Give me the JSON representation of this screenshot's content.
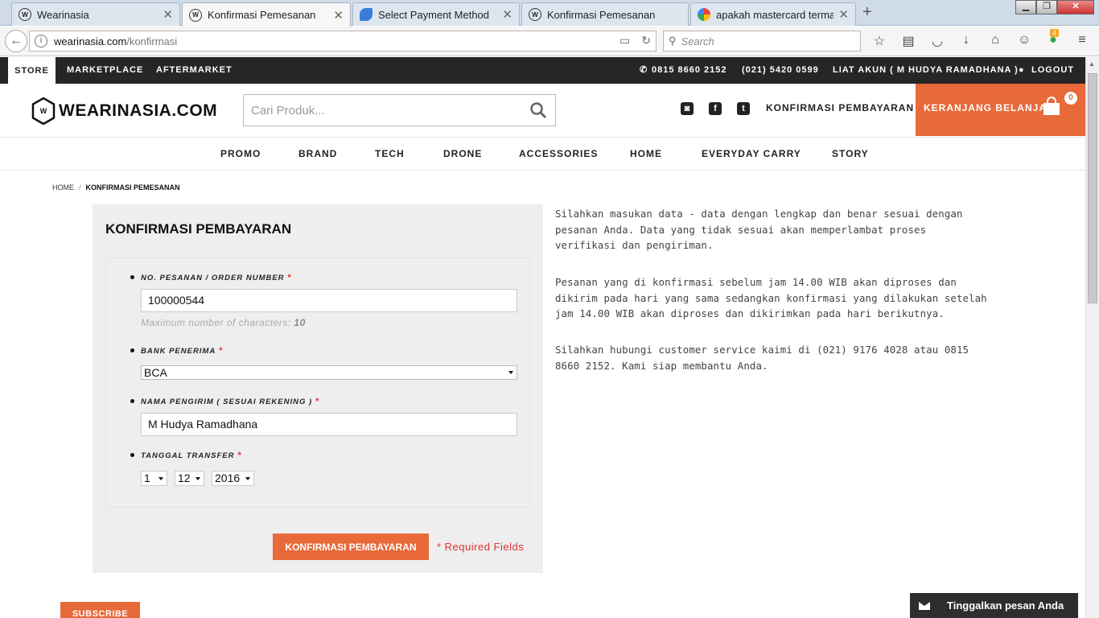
{
  "browser": {
    "tabs": [
      {
        "title": "Wearinasia",
        "active": false
      },
      {
        "title": "Konfirmasi Pemesanan",
        "active": true
      },
      {
        "title": "Select Payment Method",
        "active": false
      },
      {
        "title": "Konfirmasi Pemesanan",
        "active": false
      },
      {
        "title": "apakah mastercard termas...",
        "active": false
      }
    ],
    "url_host": "wearinasia.com",
    "url_path": "/konfirmasi",
    "search_placeholder": "Search",
    "addon_badge": "4"
  },
  "topbar": {
    "store": "STORE",
    "marketplace": "MARKETPLACE",
    "aftermarket": "AFTERMARKET",
    "phone1": "0815 8660 2152",
    "phone2": "(021) 5420 0599",
    "account": "LIAT AKUN ( M HUDYA RAMADHANA )",
    "logout": "LOGOUT"
  },
  "header": {
    "logo_text": "WEARINASIA.COM",
    "search_placeholder": "Cari Produk...",
    "konfirmasi_link": "KONFIRMASI PEMBAYARAN",
    "cart_label": "KERANJANG BELANJA",
    "cart_count": "0"
  },
  "categories": [
    "PROMO",
    "BRAND",
    "TECH",
    "DRONE",
    "ACCESSORIES",
    "HOME",
    "EVERYDAY CARRY",
    "STORY"
  ],
  "breadcrumb": {
    "home": "HOME",
    "separator": "/",
    "current": "KONFIRMASI PEMESANAN"
  },
  "form": {
    "title": "KONFIRMASI PEMBAYARAN",
    "order_label": "NO. PESANAN / ORDER NUMBER",
    "order_value": "100000544",
    "order_hint_text": "Maximum number of characters:",
    "order_hint_max": "10",
    "bank_label": "BANK PENERIMA",
    "bank_value": "BCA",
    "sender_label": "NAMA PENGIRIM ( SESUAI REKENING )",
    "sender_value": "M Hudya Ramadhana",
    "date_label": "TANGGAL TRANSFER",
    "date_day": "1",
    "date_month": "12",
    "date_year": "2016",
    "required_mark": "*",
    "submit_label": "KONFIRMASI PEMBAYARAN",
    "required_fields": "* Required Fields"
  },
  "info": {
    "p1": "Silahkan masukan data - data dengan lengkap dan benar sesuai dengan pesanan Anda. Data yang tidak sesuai akan memperlambat proses verifikasi dan pengiriman.",
    "p2": "Pesanan yang di konfirmasi sebelum jam 14.00 WIB akan diproses dan dikirim pada hari yang sama sedangkan konfirmasi yang dilakukan setelah jam 14.00 WIB akan diproses dan dikirimkan pada hari berikutnya.",
    "p3": "Silahkan hubungi customer service kaimi di (021) 9176 4028 atau 0815 8660 2152. Kami siap membantu Anda."
  },
  "footer": {
    "subscribe": "SUBSCRIBE",
    "chat_label": "Tinggalkan pesan Anda"
  },
  "colors": {
    "accent": "#e8693a",
    "topbar_bg": "#262626",
    "panel_bg": "#eeeeee",
    "required": "#dd3333"
  }
}
